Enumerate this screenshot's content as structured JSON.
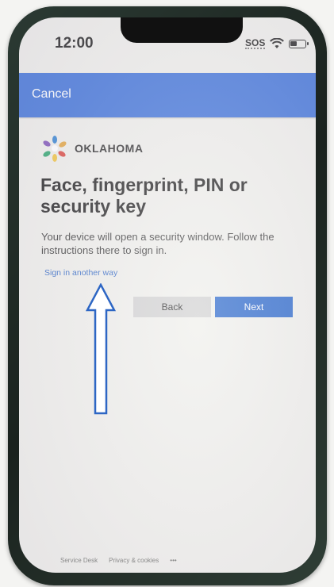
{
  "status_bar": {
    "time": "12:00",
    "sos": "SOS"
  },
  "header": {
    "cancel_label": "Cancel"
  },
  "brand": {
    "logo_text": "OKLAHOMA"
  },
  "main": {
    "title": "Face, fingerprint, PIN or security key",
    "description": "Your device will open a security window. Follow the instructions there to sign in.",
    "alt_link": "Sign in another way",
    "back_label": "Back",
    "next_label": "Next"
  },
  "footer": {
    "items": [
      "Service Desk",
      "Privacy & cookies",
      "•••"
    ]
  },
  "colors": {
    "header_blue": "#3a6fd8",
    "primary_button": "#2060c8",
    "secondary_button": "#cfcfcf",
    "link": "#2b64c4"
  },
  "annotation": {
    "arrow_icon": "up-arrow-outline-icon"
  }
}
